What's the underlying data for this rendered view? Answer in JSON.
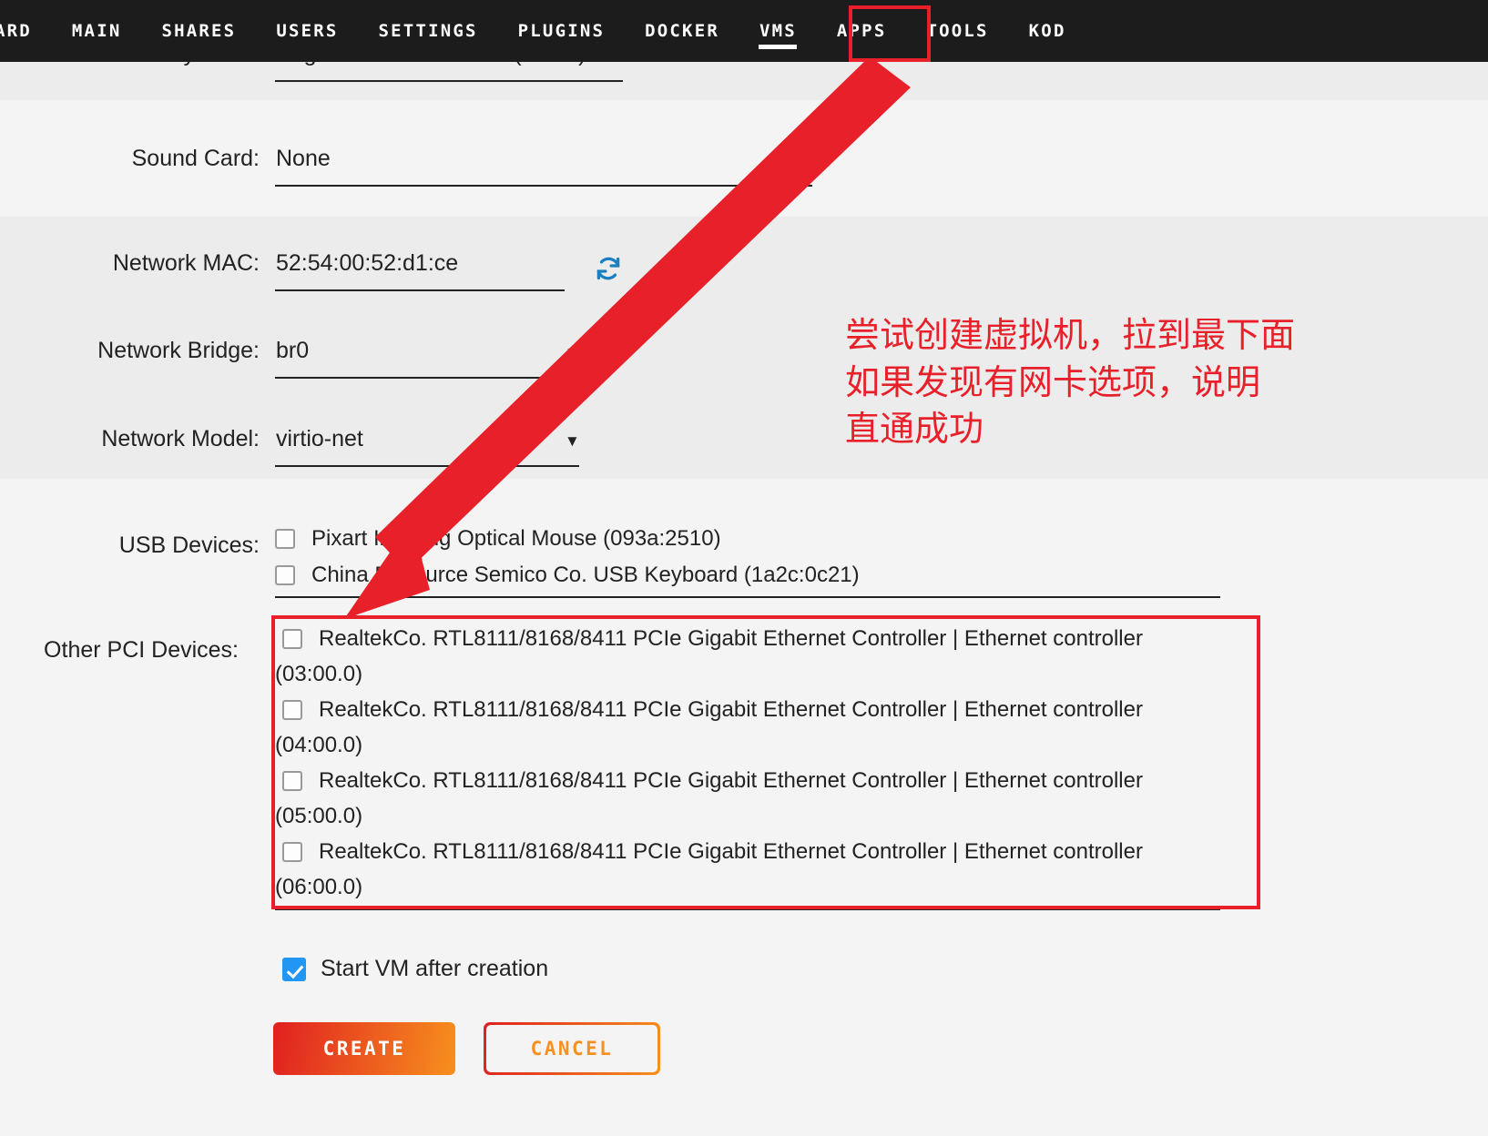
{
  "nav": {
    "items": [
      {
        "label": "ARD",
        "active": false
      },
      {
        "label": "MAIN",
        "active": false
      },
      {
        "label": "SHARES",
        "active": false
      },
      {
        "label": "USERS",
        "active": false
      },
      {
        "label": "SETTINGS",
        "active": false
      },
      {
        "label": "PLUGINS",
        "active": false
      },
      {
        "label": "DOCKER",
        "active": false
      },
      {
        "label": "VMS",
        "active": true
      },
      {
        "label": "APPS",
        "active": false
      },
      {
        "label": "TOOLS",
        "active": false
      },
      {
        "label": "KOD",
        "active": false
      }
    ]
  },
  "form": {
    "vnc_keyboard": {
      "label": "VNC Keyboard:",
      "value": "English - United States (en-us)"
    },
    "sound_card": {
      "label": "Sound Card:",
      "value": "None"
    },
    "network_mac": {
      "label": "Network MAC:",
      "value": "52:54:00:52:d1:ce",
      "refresh_icon": "refresh-icon"
    },
    "network_bridge": {
      "label": "Network Bridge:",
      "value": "br0"
    },
    "network_model": {
      "label": "Network Model:",
      "value": "virtio-net"
    },
    "usb_devices": {
      "label": "USB Devices:",
      "items": [
        {
          "text": "Pixart Imaging Optical Mouse (093a:2510)",
          "checked": false
        },
        {
          "text": "China Resource Semico Co. USB Keyboard (1a2c:0c21)",
          "checked": false
        }
      ]
    },
    "pci_devices": {
      "label": "Other PCI Devices:",
      "items": [
        {
          "name": "RealtekCo. RTL8111/8168/8411 PCIe Gigabit Ethernet Controller | Ethernet controller",
          "slot": "(03:00.0)",
          "checked": false
        },
        {
          "name": "RealtekCo. RTL8111/8168/8411 PCIe Gigabit Ethernet Controller | Ethernet controller",
          "slot": "(04:00.0)",
          "checked": false
        },
        {
          "name": "RealtekCo. RTL8111/8168/8411 PCIe Gigabit Ethernet Controller | Ethernet controller",
          "slot": "(05:00.0)",
          "checked": false
        },
        {
          "name": "RealtekCo. RTL8111/8168/8411 PCIe Gigabit Ethernet Controller | Ethernet controller",
          "slot": "(06:00.0)",
          "checked": false
        }
      ]
    },
    "start_vm": {
      "label": "Start VM after creation",
      "checked": true
    },
    "buttons": {
      "create": "CREATE",
      "cancel": "CANCEL"
    }
  },
  "annotation": {
    "line1": "尝试创建虚拟机，拉到最下面",
    "line2": "如果发现有网卡选项，说明",
    "line3": "直通成功",
    "color": "#e8202a",
    "arrow": "red-arrow",
    "highlight_vms": "red-box-vms-tab",
    "highlight_pci": "red-box-pci-list"
  },
  "colors": {
    "navbar_bg": "#1c1c1c",
    "stripe_light": "#f4f4f4",
    "stripe_dark": "#ececec",
    "accent_red": "#e02020",
    "accent_orange": "#f7901e",
    "checkbox_blue": "#2196f3",
    "refresh_blue": "#1a7fc1",
    "annotation_red": "#e8202a"
  }
}
